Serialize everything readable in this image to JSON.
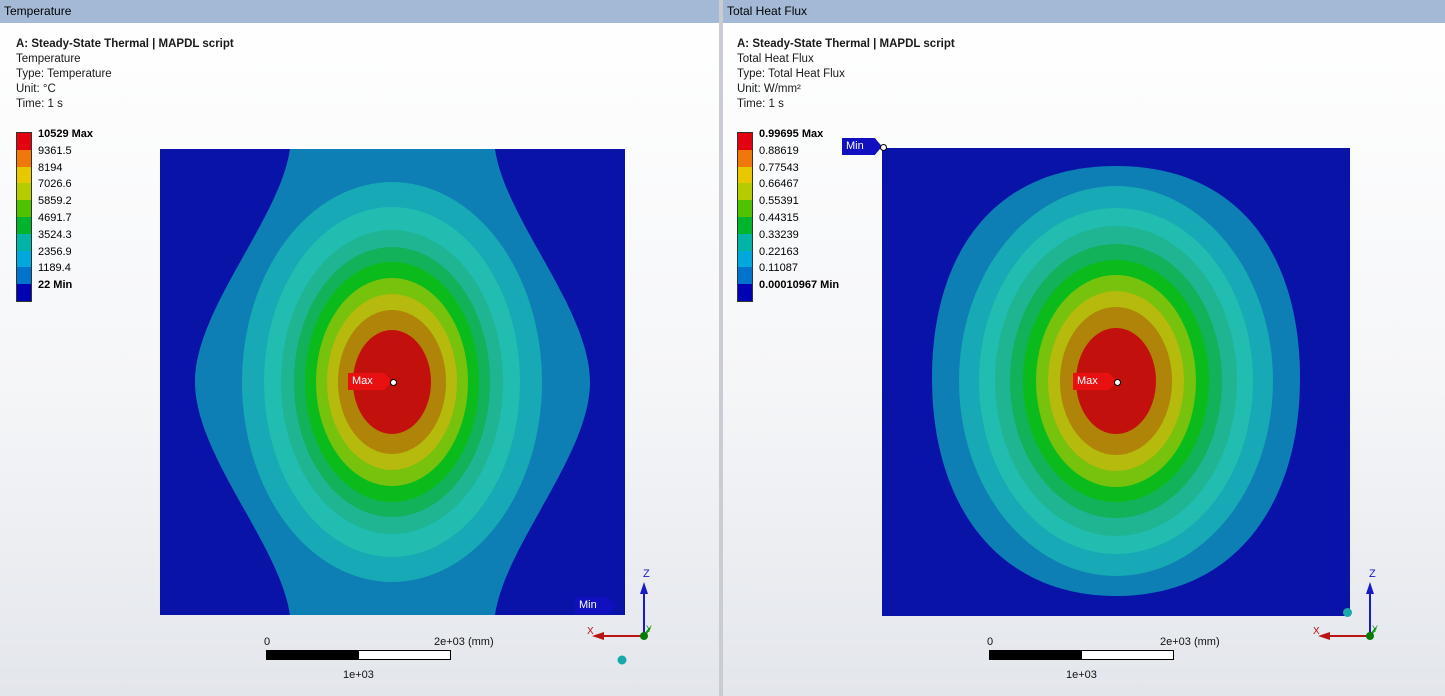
{
  "left": {
    "title": "Temperature",
    "info": {
      "header": "A: Steady-State Thermal | MAPDL script",
      "result": "Temperature",
      "type": "Type: Temperature",
      "unit": "Unit: °C",
      "time": "Time: 1 s"
    },
    "legend": {
      "labels": [
        "10529 Max",
        "9361.5",
        "8194",
        "7026.6",
        "5859.2",
        "4691.7",
        "3524.3",
        "2356.9",
        "1189.4",
        "22 Min"
      ],
      "colors": [
        "#e3000f",
        "#f0780a",
        "#e8c800",
        "#b5cc00",
        "#4fc300",
        "#00b52b",
        "#00b5a6",
        "#00a8dd",
        "#0073cc",
        "#0000b4"
      ]
    },
    "probes": {
      "max": "Max",
      "min": "Min"
    },
    "scale": {
      "start": "0",
      "end": "2e+03 (mm)",
      "mid": "1e+03"
    },
    "axes": {
      "z": "Z",
      "x": "X",
      "y": "Y"
    }
  },
  "right": {
    "title": "Total Heat Flux",
    "info": {
      "header": "A: Steady-State Thermal | MAPDL script",
      "result": "Total Heat Flux",
      "type": "Type: Total Heat Flux",
      "unit": "Unit: W/mm²",
      "time": "Time: 1 s"
    },
    "legend": {
      "labels": [
        "0.99695 Max",
        "0.88619",
        "0.77543",
        "0.66467",
        "0.55391",
        "0.44315",
        "0.33239",
        "0.22163",
        "0.11087",
        "0.00010967 Min"
      ],
      "colors": [
        "#e3000f",
        "#f0780a",
        "#e8c800",
        "#b5cc00",
        "#4fc300",
        "#00b52b",
        "#00b5a6",
        "#00a8dd",
        "#0073cc",
        "#0000b4"
      ]
    },
    "probes": {
      "max": "Max",
      "min": "Min"
    },
    "scale": {
      "start": "0",
      "end": "2e+03 (mm)",
      "mid": "1e+03"
    },
    "axes": {
      "z": "Z",
      "x": "X",
      "y": "Y"
    }
  },
  "contour_colors": {
    "dark_blue": "#0a13a8",
    "steel_blue": "#0d7fb5",
    "light_teal": "#17a9b5",
    "cyan_teal": "#20bdb0",
    "mint": "#1fb593",
    "green_teal": "#11b25a",
    "green": "#0bbb1c",
    "yellow_green": "#77c20c",
    "olive": "#b6ba0c",
    "dark_olive": "#a89a08",
    "orange_brown": "#b5730a",
    "red": "#c2100c"
  }
}
